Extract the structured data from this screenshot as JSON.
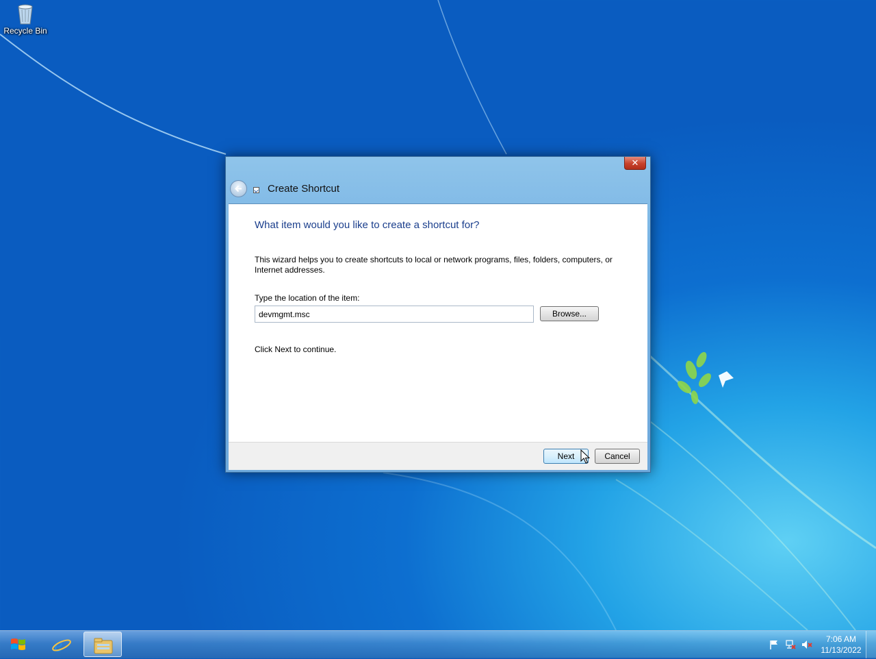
{
  "desktop": {
    "icons": [
      {
        "label": "Recycle Bin",
        "icon": "recycle-bin-icon"
      }
    ]
  },
  "dialog": {
    "title": "Create Shortcut",
    "heading": "What item would you like to create a shortcut for?",
    "description": "This wizard helps you to create shortcuts to local or network programs, files, folders, computers, or Internet addresses.",
    "location_label": "Type the location of the item:",
    "location_value": "devmgmt.msc",
    "browse_label": "Browse...",
    "continue_text": "Click Next to continue.",
    "next_label": "Next",
    "cancel_label": "Cancel",
    "close_glyph": "✕"
  },
  "taskbar": {
    "pinned": [
      "start-orb-icon",
      "internet-explorer-icon",
      "windows-explorer-icon"
    ],
    "tray_icons": [
      "action-center-flag-icon",
      "network-icon",
      "volume-muted-icon"
    ],
    "time": "7:06 AM",
    "date": "11/13/2022"
  },
  "colors": {
    "dialog_heading": "#1a3e8c",
    "desktop_bg": "#0d6fd0",
    "close_button": "#c7412b"
  }
}
